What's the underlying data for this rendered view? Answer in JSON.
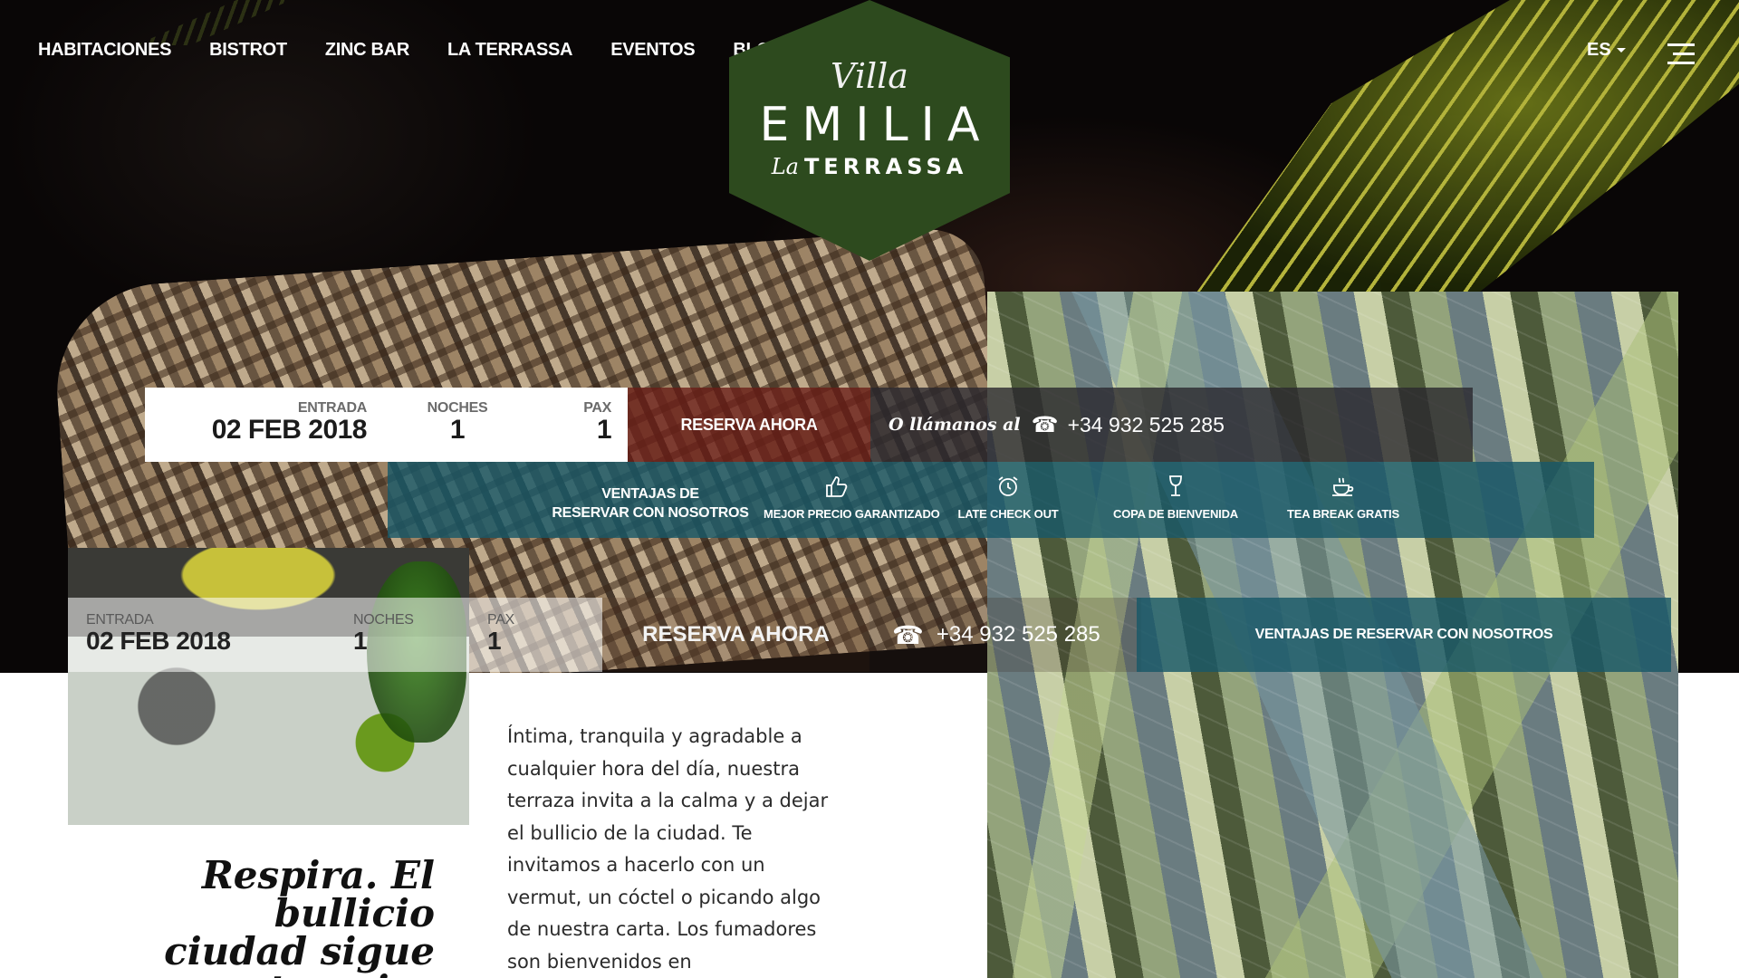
{
  "nav": {
    "items": [
      "HABITACIONES",
      "BISTROT",
      "ZINC BAR",
      "LA TERRASSA",
      "EVENTOS",
      "BLOG"
    ],
    "language": "ES"
  },
  "logo": {
    "line1": "Villa",
    "line2": "EMILIA",
    "line3_prefix": "La",
    "line3": "TERRASSA",
    "color": "#2d4a1e"
  },
  "booking": {
    "entrada_label": "ENTRADA",
    "entrada_value": "02 FEB 2018",
    "noches_label": "NOCHES",
    "noches_value": "1",
    "pax_label": "PAX",
    "pax_value": "1",
    "reserve_label": "RESERVA AHORA",
    "call_lead": "O llámanos al",
    "phone": "+34 932 525 285"
  },
  "benefits": {
    "title_line1": "VENTAJAS DE",
    "title_line2": "RESERVAR CON NOSOTROS",
    "items": [
      {
        "icon": "thumbs-up-icon",
        "label": "MEJOR PRECIO GARANTIZADO"
      },
      {
        "icon": "alarm-clock-icon",
        "label": "LATE CHECK OUT"
      },
      {
        "icon": "wine-glass-icon",
        "label": "COPA DE BIENVENIDA"
      },
      {
        "icon": "coffee-cup-icon",
        "label": "TEA BREAK GRATIS"
      }
    ]
  },
  "sticky_booking": {
    "entrada_label": "ENTRADA",
    "entrada_value": "02 FEB 2018",
    "noches_label": "NOCHES",
    "noches_value": "1",
    "pax_label": "PAX",
    "pax_value": "1",
    "reserve_label": "RESERVA AHORA",
    "phone": "+34 932 525 285",
    "advantages_label": "VENTAJAS DE RESERVAR CON NOSOTROS"
  },
  "content": {
    "headline": "Respira. El bullicio ciudad sigue a tus pies",
    "body": "Íntima, tranquila y agradable a cualquier hora del día, nuestra terraza invita a la calma y a dejar el bullicio de la ciudad. Te invitamos a hacerlo con un vermut, un cóctel o picando algo de nuestra carta. Los fumadores son bienvenidos en"
  },
  "colors": {
    "reserve_red": "#691c16",
    "benefits_teal": "#185868",
    "call_dark": "#2a282e"
  }
}
